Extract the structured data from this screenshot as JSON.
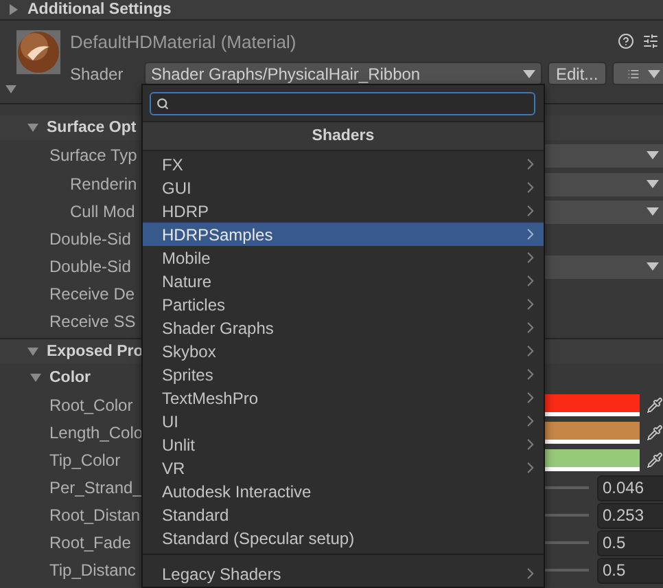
{
  "additional_settings": {
    "title": "Additional Settings",
    "expanded": false
  },
  "material": {
    "title": "DefaultHDMaterial (Material)",
    "expanded": true,
    "shader_label": "Shader",
    "shader": "Shader Graphs/PhysicalHair_Ribbon",
    "edit_button": "Edit..."
  },
  "surface_options": {
    "title": "Surface Opt",
    "expanded": true,
    "rows": [
      {
        "label": "Surface Typ",
        "kind": "dropdown",
        "children": [
          {
            "label": "Renderin",
            "kind": "dropdown"
          },
          {
            "label": "Cull Mod",
            "kind": "dropdown"
          }
        ]
      },
      {
        "label": "Double-Sid",
        "kind": "label"
      },
      {
        "label": "Double-Sid",
        "kind": "dropdown"
      },
      {
        "label": "Receive De",
        "kind": "label"
      },
      {
        "label": "Receive SS",
        "kind": "label"
      }
    ]
  },
  "exposed_properties": {
    "title": "Exposed Pro",
    "expanded": true,
    "groups": [
      {
        "title": "Color",
        "expanded": true,
        "rows": [
          {
            "label": "Root_Color",
            "kind": "color",
            "color": "#fb2a16"
          },
          {
            "label": "Length_Colo",
            "kind": "color",
            "color": "#c58647"
          },
          {
            "label": "Tip_Color",
            "kind": "color",
            "color": "#97c97b"
          },
          {
            "label": "Per_Strand_",
            "kind": "slider",
            "value": "0.046"
          },
          {
            "label": "Root_Distan",
            "kind": "slider",
            "value": "0.253"
          },
          {
            "label": "Root_Fade",
            "kind": "slider",
            "value": "0.5"
          },
          {
            "label": "Tip_Distanc",
            "kind": "slider",
            "value": "0.5"
          }
        ]
      }
    ]
  },
  "shader_popup": {
    "title": "Shaders",
    "items": [
      {
        "label": "FX",
        "kind": "submenu",
        "selected": false
      },
      {
        "label": "GUI",
        "kind": "submenu",
        "selected": false
      },
      {
        "label": "HDRP",
        "kind": "submenu",
        "selected": false
      },
      {
        "label": "HDRPSamples",
        "kind": "submenu",
        "selected": true
      },
      {
        "label": "Mobile",
        "kind": "submenu",
        "selected": false
      },
      {
        "label": "Nature",
        "kind": "submenu",
        "selected": false
      },
      {
        "label": "Particles",
        "kind": "submenu",
        "selected": false
      },
      {
        "label": "Shader Graphs",
        "kind": "submenu",
        "selected": false
      },
      {
        "label": "Skybox",
        "kind": "submenu",
        "selected": false
      },
      {
        "label": "Sprites",
        "kind": "submenu",
        "selected": false
      },
      {
        "label": "TextMeshPro",
        "kind": "submenu",
        "selected": false
      },
      {
        "label": "UI",
        "kind": "submenu",
        "selected": false
      },
      {
        "label": "Unlit",
        "kind": "submenu",
        "selected": false
      },
      {
        "label": "VR",
        "kind": "submenu",
        "selected": false
      },
      {
        "label": "Autodesk Interactive",
        "kind": "shader",
        "selected": false
      },
      {
        "label": "Standard",
        "kind": "shader",
        "selected": false
      },
      {
        "label": "Standard (Specular setup)",
        "kind": "shader",
        "selected": false
      }
    ],
    "footer_items": [
      {
        "label": "Legacy Shaders",
        "kind": "submenu",
        "selected": false
      }
    ]
  }
}
